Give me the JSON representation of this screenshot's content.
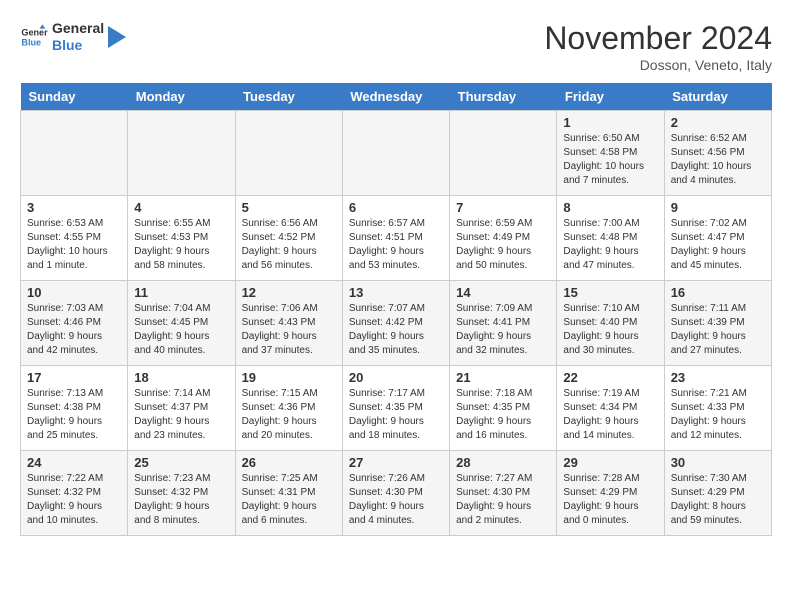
{
  "header": {
    "logo_text_general": "General",
    "logo_text_blue": "Blue",
    "month_title": "November 2024",
    "location": "Dosson, Veneto, Italy"
  },
  "weekdays": [
    "Sunday",
    "Monday",
    "Tuesday",
    "Wednesday",
    "Thursday",
    "Friday",
    "Saturday"
  ],
  "weeks": [
    [
      {
        "day": "",
        "info": ""
      },
      {
        "day": "",
        "info": ""
      },
      {
        "day": "",
        "info": ""
      },
      {
        "day": "",
        "info": ""
      },
      {
        "day": "",
        "info": ""
      },
      {
        "day": "1",
        "info": "Sunrise: 6:50 AM\nSunset: 4:58 PM\nDaylight: 10 hours and 7 minutes."
      },
      {
        "day": "2",
        "info": "Sunrise: 6:52 AM\nSunset: 4:56 PM\nDaylight: 10 hours and 4 minutes."
      }
    ],
    [
      {
        "day": "3",
        "info": "Sunrise: 6:53 AM\nSunset: 4:55 PM\nDaylight: 10 hours and 1 minute."
      },
      {
        "day": "4",
        "info": "Sunrise: 6:55 AM\nSunset: 4:53 PM\nDaylight: 9 hours and 58 minutes."
      },
      {
        "day": "5",
        "info": "Sunrise: 6:56 AM\nSunset: 4:52 PM\nDaylight: 9 hours and 56 minutes."
      },
      {
        "day": "6",
        "info": "Sunrise: 6:57 AM\nSunset: 4:51 PM\nDaylight: 9 hours and 53 minutes."
      },
      {
        "day": "7",
        "info": "Sunrise: 6:59 AM\nSunset: 4:49 PM\nDaylight: 9 hours and 50 minutes."
      },
      {
        "day": "8",
        "info": "Sunrise: 7:00 AM\nSunset: 4:48 PM\nDaylight: 9 hours and 47 minutes."
      },
      {
        "day": "9",
        "info": "Sunrise: 7:02 AM\nSunset: 4:47 PM\nDaylight: 9 hours and 45 minutes."
      }
    ],
    [
      {
        "day": "10",
        "info": "Sunrise: 7:03 AM\nSunset: 4:46 PM\nDaylight: 9 hours and 42 minutes."
      },
      {
        "day": "11",
        "info": "Sunrise: 7:04 AM\nSunset: 4:45 PM\nDaylight: 9 hours and 40 minutes."
      },
      {
        "day": "12",
        "info": "Sunrise: 7:06 AM\nSunset: 4:43 PM\nDaylight: 9 hours and 37 minutes."
      },
      {
        "day": "13",
        "info": "Sunrise: 7:07 AM\nSunset: 4:42 PM\nDaylight: 9 hours and 35 minutes."
      },
      {
        "day": "14",
        "info": "Sunrise: 7:09 AM\nSunset: 4:41 PM\nDaylight: 9 hours and 32 minutes."
      },
      {
        "day": "15",
        "info": "Sunrise: 7:10 AM\nSunset: 4:40 PM\nDaylight: 9 hours and 30 minutes."
      },
      {
        "day": "16",
        "info": "Sunrise: 7:11 AM\nSunset: 4:39 PM\nDaylight: 9 hours and 27 minutes."
      }
    ],
    [
      {
        "day": "17",
        "info": "Sunrise: 7:13 AM\nSunset: 4:38 PM\nDaylight: 9 hours and 25 minutes."
      },
      {
        "day": "18",
        "info": "Sunrise: 7:14 AM\nSunset: 4:37 PM\nDaylight: 9 hours and 23 minutes."
      },
      {
        "day": "19",
        "info": "Sunrise: 7:15 AM\nSunset: 4:36 PM\nDaylight: 9 hours and 20 minutes."
      },
      {
        "day": "20",
        "info": "Sunrise: 7:17 AM\nSunset: 4:35 PM\nDaylight: 9 hours and 18 minutes."
      },
      {
        "day": "21",
        "info": "Sunrise: 7:18 AM\nSunset: 4:35 PM\nDaylight: 9 hours and 16 minutes."
      },
      {
        "day": "22",
        "info": "Sunrise: 7:19 AM\nSunset: 4:34 PM\nDaylight: 9 hours and 14 minutes."
      },
      {
        "day": "23",
        "info": "Sunrise: 7:21 AM\nSunset: 4:33 PM\nDaylight: 9 hours and 12 minutes."
      }
    ],
    [
      {
        "day": "24",
        "info": "Sunrise: 7:22 AM\nSunset: 4:32 PM\nDaylight: 9 hours and 10 minutes."
      },
      {
        "day": "25",
        "info": "Sunrise: 7:23 AM\nSunset: 4:32 PM\nDaylight: 9 hours and 8 minutes."
      },
      {
        "day": "26",
        "info": "Sunrise: 7:25 AM\nSunset: 4:31 PM\nDaylight: 9 hours and 6 minutes."
      },
      {
        "day": "27",
        "info": "Sunrise: 7:26 AM\nSunset: 4:30 PM\nDaylight: 9 hours and 4 minutes."
      },
      {
        "day": "28",
        "info": "Sunrise: 7:27 AM\nSunset: 4:30 PM\nDaylight: 9 hours and 2 minutes."
      },
      {
        "day": "29",
        "info": "Sunrise: 7:28 AM\nSunset: 4:29 PM\nDaylight: 9 hours and 0 minutes."
      },
      {
        "day": "30",
        "info": "Sunrise: 7:30 AM\nSunset: 4:29 PM\nDaylight: 8 hours and 59 minutes."
      }
    ]
  ]
}
